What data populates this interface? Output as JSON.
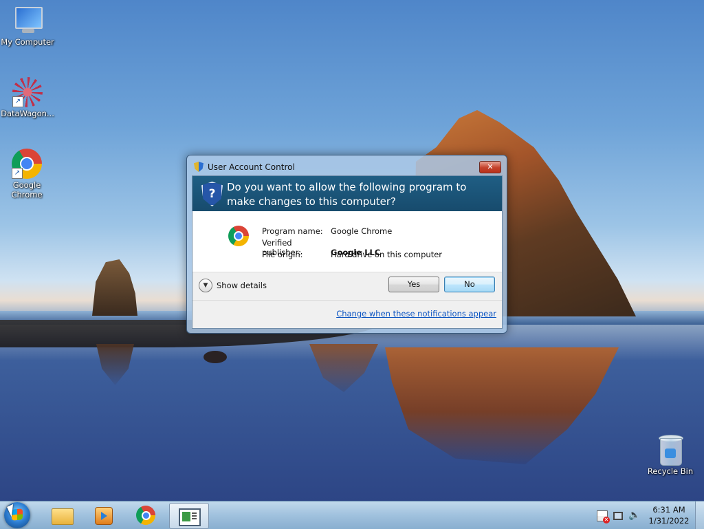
{
  "desktop": {
    "icons": [
      {
        "label": "My Computer",
        "icon": "computer-icon"
      },
      {
        "label": "DataWagon...",
        "icon": "datawagon-icon"
      },
      {
        "label": "Google Chrome",
        "icon": "chrome-icon"
      },
      {
        "label": "Recycle Bin",
        "icon": "recycle-bin-icon"
      }
    ]
  },
  "uac": {
    "title": "User Account Control",
    "close_label": "✕",
    "question": "Do you want to allow the following program to make changes to this computer?",
    "program_name_label": "Program name:",
    "program_name": "Google Chrome",
    "publisher_label": "Verified publisher:",
    "publisher": "Google LLC",
    "origin_label": "File origin:",
    "origin": "Hard drive on this computer",
    "show_details": "Show details",
    "yes_label": "Yes",
    "no_label": "No",
    "change_link": "Change when these notifications appear"
  },
  "taskbar": {
    "pinned": [
      "windows-explorer-icon",
      "media-player-icon",
      "chrome-icon",
      "uac-window-icon"
    ],
    "clock_time": "6:31 AM",
    "clock_date": "1/31/2022",
    "tray_icons": [
      "action-center-flag-icon",
      "network-icon",
      "volume-icon"
    ]
  },
  "colors": {
    "uac_banner": "#1f5e84",
    "link": "#0b54c2",
    "taskbar": "#9bbedc"
  }
}
